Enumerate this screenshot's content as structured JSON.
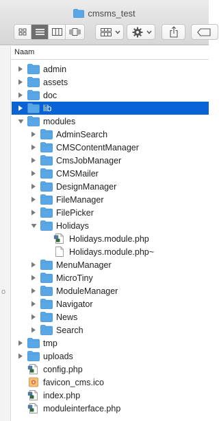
{
  "window": {
    "title": "cmsms_test"
  },
  "toolbar": {
    "view_icons": "icon-view-icon",
    "view_list": "list-view-icon",
    "view_columns": "column-view-icon",
    "view_coverflow": "cover-flow-icon",
    "arrange": "arrange-grid-icon",
    "action": "gear-icon",
    "share": "share-icon",
    "tag": "tag-icon"
  },
  "list": {
    "column_header": "Naam",
    "items": [
      {
        "name": "admin",
        "kind": "folder",
        "level": 0,
        "disclosure": "closed"
      },
      {
        "name": "assets",
        "kind": "folder",
        "level": 0,
        "disclosure": "closed"
      },
      {
        "name": "doc",
        "kind": "folder",
        "level": 0,
        "disclosure": "closed"
      },
      {
        "name": "lib",
        "kind": "folder",
        "level": 0,
        "disclosure": "closed",
        "selected": true
      },
      {
        "name": "modules",
        "kind": "folder",
        "level": 0,
        "disclosure": "open"
      },
      {
        "name": "AdminSearch",
        "kind": "folder",
        "level": 1,
        "disclosure": "closed"
      },
      {
        "name": "CMSContentManager",
        "kind": "folder",
        "level": 1,
        "disclosure": "closed"
      },
      {
        "name": "CmsJobManager",
        "kind": "folder",
        "level": 1,
        "disclosure": "closed"
      },
      {
        "name": "CMSMailer",
        "kind": "folder",
        "level": 1,
        "disclosure": "closed"
      },
      {
        "name": "DesignManager",
        "kind": "folder",
        "level": 1,
        "disclosure": "closed"
      },
      {
        "name": "FileManager",
        "kind": "folder",
        "level": 1,
        "disclosure": "closed"
      },
      {
        "name": "FilePicker",
        "kind": "folder",
        "level": 1,
        "disclosure": "closed"
      },
      {
        "name": "Holidays",
        "kind": "folder",
        "level": 1,
        "disclosure": "open"
      },
      {
        "name": "Holidays.module.php",
        "kind": "php",
        "level": 2,
        "disclosure": "none"
      },
      {
        "name": "Holidays.module.php~",
        "kind": "doc",
        "level": 2,
        "disclosure": "none"
      },
      {
        "name": "MenuManager",
        "kind": "folder",
        "level": 1,
        "disclosure": "closed"
      },
      {
        "name": "MicroTiny",
        "kind": "folder",
        "level": 1,
        "disclosure": "closed"
      },
      {
        "name": "ModuleManager",
        "kind": "folder",
        "level": 1,
        "disclosure": "closed"
      },
      {
        "name": "Navigator",
        "kind": "folder",
        "level": 1,
        "disclosure": "closed"
      },
      {
        "name": "News",
        "kind": "folder",
        "level": 1,
        "disclosure": "closed"
      },
      {
        "name": "Search",
        "kind": "folder",
        "level": 1,
        "disclosure": "closed"
      },
      {
        "name": "tmp",
        "kind": "folder",
        "level": 0,
        "disclosure": "closed"
      },
      {
        "name": "uploads",
        "kind": "folder",
        "level": 0,
        "disclosure": "closed"
      },
      {
        "name": "config.php",
        "kind": "php",
        "level": 0,
        "disclosure": "none"
      },
      {
        "name": "favicon_cms.ico",
        "kind": "ico",
        "level": 0,
        "disclosure": "none"
      },
      {
        "name": "index.php",
        "kind": "php",
        "level": 0,
        "disclosure": "none"
      },
      {
        "name": "moduleinterface.php",
        "kind": "php",
        "level": 0,
        "disclosure": "none"
      }
    ]
  },
  "sidebar": {
    "partial_text": "o"
  },
  "colors": {
    "selection": "#0a63d6",
    "folder": "#5aa7e8",
    "folder_dark": "#3e8fd6"
  }
}
